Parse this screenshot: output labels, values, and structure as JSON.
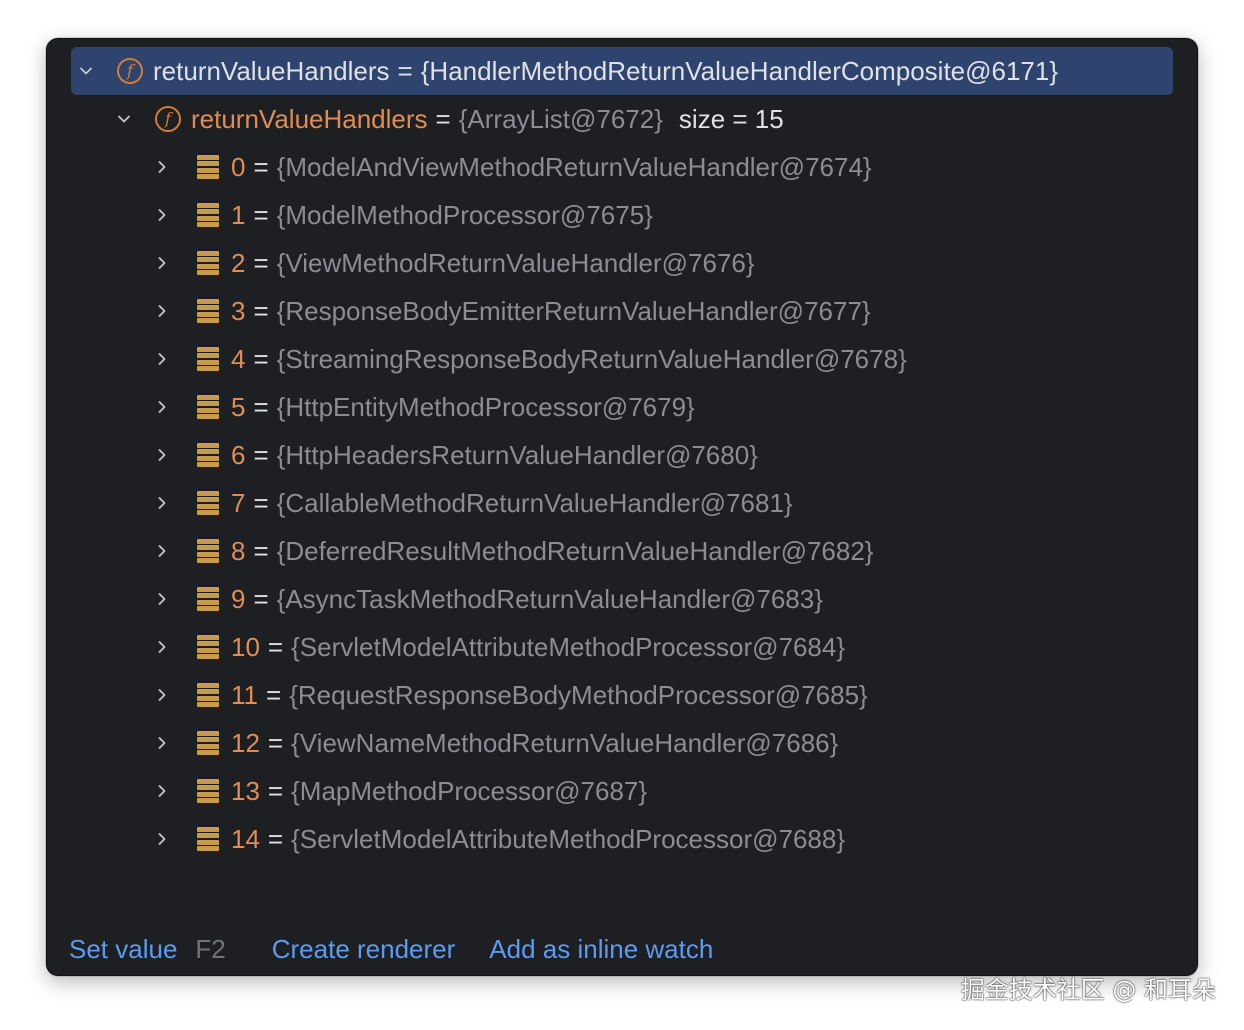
{
  "root": {
    "name": "returnValueHandlers",
    "equals": "=",
    "value": "{HandlerMethodReturnValueHandlerComposite@6171}"
  },
  "list": {
    "name": "returnValueHandlers",
    "equals": "=",
    "value": "{ArrayList@7672}",
    "size": "size = 15"
  },
  "items": [
    {
      "index": "0",
      "value": "{ModelAndViewMethodReturnValueHandler@7674}"
    },
    {
      "index": "1",
      "value": "{ModelMethodProcessor@7675}"
    },
    {
      "index": "2",
      "value": "{ViewMethodReturnValueHandler@7676}"
    },
    {
      "index": "3",
      "value": "{ResponseBodyEmitterReturnValueHandler@7677}"
    },
    {
      "index": "4",
      "value": "{StreamingResponseBodyReturnValueHandler@7678}"
    },
    {
      "index": "5",
      "value": "{HttpEntityMethodProcessor@7679}"
    },
    {
      "index": "6",
      "value": "{HttpHeadersReturnValueHandler@7680}"
    },
    {
      "index": "7",
      "value": "{CallableMethodReturnValueHandler@7681}"
    },
    {
      "index": "8",
      "value": "{DeferredResultMethodReturnValueHandler@7682}"
    },
    {
      "index": "9",
      "value": "{AsyncTaskMethodReturnValueHandler@7683}"
    },
    {
      "index": "10",
      "value": "{ServletModelAttributeMethodProcessor@7684}"
    },
    {
      "index": "11",
      "value": "{RequestResponseBodyMethodProcessor@7685}"
    },
    {
      "index": "12",
      "value": "{ViewNameMethodReturnValueHandler@7686}"
    },
    {
      "index": "13",
      "value": "{MapMethodProcessor@7687}"
    },
    {
      "index": "14",
      "value": "{ServletModelAttributeMethodProcessor@7688}"
    }
  ],
  "footer": {
    "set_value": "Set value",
    "set_value_shortcut": "F2",
    "create_renderer": "Create renderer",
    "add_inline_watch": "Add as inline watch"
  },
  "watermark": "掘金技术社区 @ 和耳朵",
  "colors": {
    "background": "#1e1f22",
    "selection": "#2e436e",
    "field_name": "#e08d54",
    "value_grey": "#8a8d93",
    "link": "#5c9bf0"
  }
}
